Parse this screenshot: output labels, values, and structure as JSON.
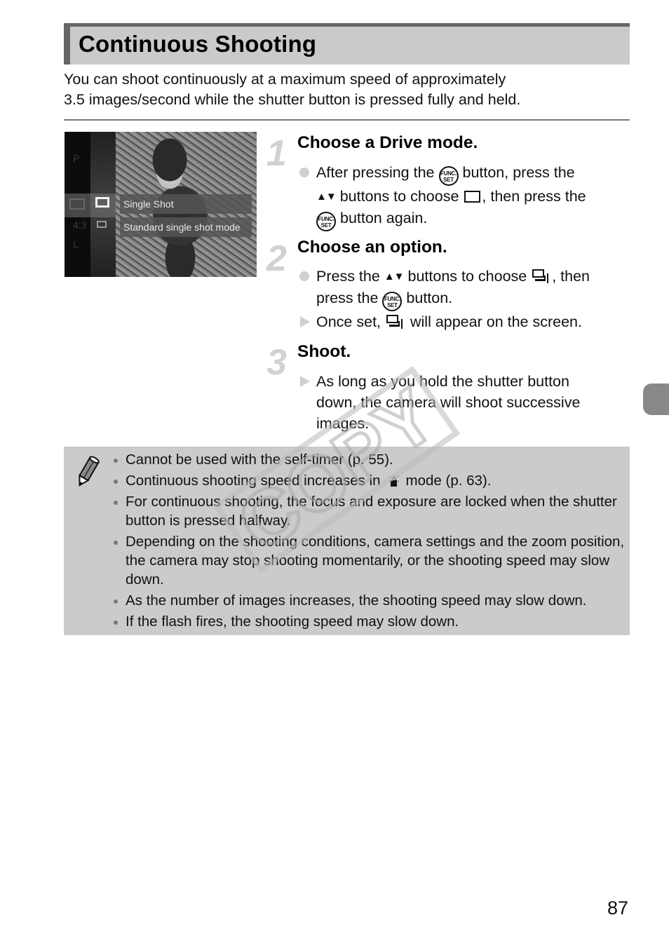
{
  "header": {
    "title": "Continuous Shooting"
  },
  "intro": {
    "line1": "You can shoot continuously at a maximum speed of approximately",
    "line2": "3.5 images/second while the shutter button is pressed fully and held."
  },
  "screen_image": {
    "labels": [
      "Single Shot",
      "Standard single shot mode"
    ],
    "side_items": [
      "P",
      "4:3",
      "L"
    ]
  },
  "steps": [
    {
      "number": "1",
      "title": "Choose a Drive mode.",
      "items": [
        {
          "marker": "dot",
          "parts": [
            "After pressing the",
            "button, press the",
            "buttons to choose",
            ", then press the",
            "button again."
          ]
        }
      ]
    },
    {
      "number": "2",
      "title": "Choose an option.",
      "items": [
        {
          "marker": "dot",
          "parts": [
            "Press the",
            "buttons to choose",
            ", then",
            "press the",
            "button."
          ]
        },
        {
          "marker": "triangle",
          "parts": [
            "Once set,",
            "will appear on the screen."
          ]
        }
      ]
    },
    {
      "number": "3",
      "title": "Shoot.",
      "items": [
        {
          "marker": "triangle",
          "text": "As long as you hold the shutter button down, the camera will shoot successive images."
        }
      ]
    }
  ],
  "icons": {
    "func_set": [
      "FUNC.",
      "SET"
    ],
    "up_down": "▲▼"
  },
  "notes": {
    "items": [
      {
        "text": "Cannot be used with the self-timer (p. 55)."
      },
      {
        "before": "Continuous shooting speed increases in",
        "after": "mode (p. 63)."
      },
      {
        "text": "For continuous shooting, the focus and exposure are locked when the shutter button is pressed halfway."
      },
      {
        "text": "Depending on the shooting conditions, camera settings and the zoom position, the camera may stop shooting momentarily, or the shooting speed may slow down."
      },
      {
        "text": "As the number of images increases, the shooting speed may slow down."
      },
      {
        "text": "If the flash fires, the shooting speed may slow down."
      }
    ]
  },
  "watermark": "COPY",
  "page_number": "87",
  "colors": {
    "title_bg": "#cacaca",
    "title_accent": "#666666",
    "note_bg": "#cbcbcb",
    "step_number": "#d2d2d2",
    "side_tab": "#888888"
  }
}
